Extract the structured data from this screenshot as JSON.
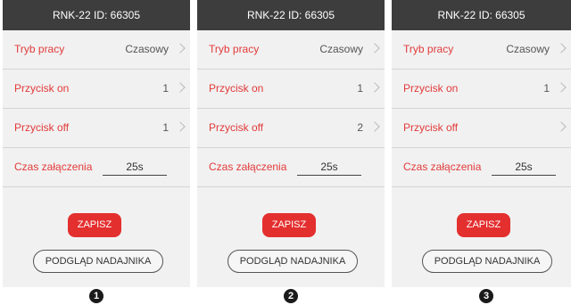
{
  "screens": [
    {
      "header": "RNK-22 ID: 66305",
      "mode": {
        "label": "Tryb pracy",
        "value": "Czasowy"
      },
      "button_on": {
        "label": "Przycisk on",
        "value": "1"
      },
      "button_off": {
        "label": "Przycisk off",
        "value": "1"
      },
      "on_time": {
        "label": "Czas załączenia",
        "value": "25s"
      },
      "save_label": "ZAPISZ",
      "preview_label": "PODGLĄD NADAJNIKA",
      "marker": "1"
    },
    {
      "header": "RNK-22 ID: 66305",
      "mode": {
        "label": "Tryb pracy",
        "value": "Czasowy"
      },
      "button_on": {
        "label": "Przycisk on",
        "value": "1"
      },
      "button_off": {
        "label": "Przycisk off",
        "value": "2"
      },
      "on_time": {
        "label": "Czas załączenia",
        "value": "25s"
      },
      "save_label": "ZAPISZ",
      "preview_label": "PODGLĄD NADAJNIKA",
      "marker": "2"
    },
    {
      "header": "RNK-22 ID: 66305",
      "mode": {
        "label": "Tryb pracy",
        "value": "Czasowy"
      },
      "button_on": {
        "label": "Przycisk on",
        "value": "1"
      },
      "button_off": {
        "label": "Przycisk off",
        "value": ""
      },
      "on_time": {
        "label": "Czas załączenia",
        "value": "25s"
      },
      "save_label": "ZAPISZ",
      "preview_label": "PODGLĄD NADAJNIKA",
      "marker": "3"
    }
  ],
  "colors": {
    "header_bg": "#3d3d3d",
    "label_red": "#e23a3a",
    "save_button_red": "#e42f2f",
    "screen_bg": "#f1f1f1",
    "chevron": "#b8b8b8"
  },
  "icons": {
    "row_chevron": "chevron-right-icon",
    "marker_badge": "numbered-circle"
  }
}
